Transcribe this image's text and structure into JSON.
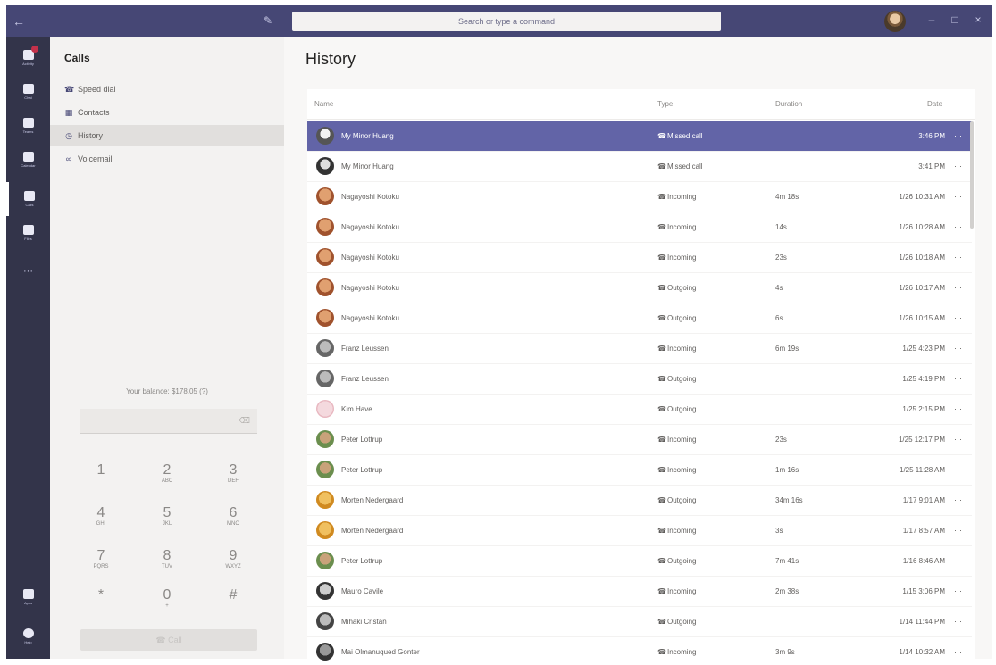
{
  "titlebar": {
    "back_icon": "←",
    "compose_icon": "✎",
    "search_placeholder": "Search or type a command",
    "minimize": "–",
    "maximize": "□",
    "close": "×"
  },
  "appbar": {
    "items": [
      {
        "label": "Activity",
        "icon": "bell-icon"
      },
      {
        "label": "Chat",
        "icon": "chat-icon"
      },
      {
        "label": "Teams",
        "icon": "teams-icon"
      },
      {
        "label": "Calendar",
        "icon": "calendar-icon"
      },
      {
        "label": "Calls",
        "icon": "phone-icon"
      },
      {
        "label": "Files",
        "icon": "file-icon"
      }
    ],
    "more": "···",
    "bottom": [
      {
        "label": "Apps",
        "icon": "apps-icon"
      },
      {
        "label": "Help",
        "icon": "help-icon"
      }
    ],
    "activity_badge_color": "#c4314b"
  },
  "leftpane": {
    "title": "Calls",
    "nav": [
      {
        "label": "Speed dial",
        "icon": "phone-icon"
      },
      {
        "label": "Contacts",
        "icon": "contacts-icon"
      },
      {
        "label": "History",
        "icon": "history-icon"
      },
      {
        "label": "Voicemail",
        "icon": "voicemail-icon"
      }
    ],
    "balance": "Your balance: $178.05 (?)",
    "keys": [
      {
        "d": "1",
        "l": ""
      },
      {
        "d": "2",
        "l": "ABC"
      },
      {
        "d": "3",
        "l": "DEF"
      },
      {
        "d": "4",
        "l": "GHI"
      },
      {
        "d": "5",
        "l": "JKL"
      },
      {
        "d": "6",
        "l": "MNO"
      },
      {
        "d": "7",
        "l": "PQRS"
      },
      {
        "d": "8",
        "l": "TUV"
      },
      {
        "d": "9",
        "l": "WXYZ"
      },
      {
        "d": "*",
        "l": ""
      },
      {
        "d": "0",
        "l": "+"
      },
      {
        "d": "#",
        "l": ""
      }
    ],
    "call_label": "Call",
    "delete_icon": "⌫"
  },
  "history": {
    "title": "History",
    "columns": {
      "name": "Name",
      "type": "Type",
      "duration": "Duration",
      "date": "Date"
    },
    "rows": [
      {
        "name": "My Minor Huang",
        "type": "Missed call",
        "duration": "",
        "date": "3:46 PM"
      },
      {
        "name": "My Minor Huang",
        "type": "Missed call",
        "duration": "",
        "date": "3:41 PM"
      },
      {
        "name": "Nagayoshi Kotoku",
        "type": "Incoming",
        "duration": "4m 18s",
        "date": "1/26 10:31 AM"
      },
      {
        "name": "Nagayoshi Kotoku",
        "type": "Incoming",
        "duration": "14s",
        "date": "1/26 10:28 AM"
      },
      {
        "name": "Nagayoshi Kotoku",
        "type": "Incoming",
        "duration": "23s",
        "date": "1/26 10:18 AM"
      },
      {
        "name": "Nagayoshi Kotoku",
        "type": "Outgoing",
        "duration": "4s",
        "date": "1/26 10:17 AM"
      },
      {
        "name": "Nagayoshi Kotoku",
        "type": "Outgoing",
        "duration": "6s",
        "date": "1/26 10:15 AM"
      },
      {
        "name": "Franz Leussen",
        "type": "Incoming",
        "duration": "6m 19s",
        "date": "1/25 4:23 PM"
      },
      {
        "name": "Franz Leussen",
        "type": "Outgoing",
        "duration": "",
        "date": "1/25 4:19 PM"
      },
      {
        "name": "Kim Have",
        "type": "Outgoing",
        "duration": "",
        "date": "1/25 2:15 PM"
      },
      {
        "name": "Peter Lottrup",
        "type": "Incoming",
        "duration": "23s",
        "date": "1/25 12:17 PM"
      },
      {
        "name": "Peter Lottrup",
        "type": "Incoming",
        "duration": "1m 16s",
        "date": "1/25 11:28 AM"
      },
      {
        "name": "Morten Nedergaard",
        "type": "Outgoing",
        "duration": "34m 16s",
        "date": "1/17 9:01 AM"
      },
      {
        "name": "Morten Nedergaard",
        "type": "Incoming",
        "duration": "3s",
        "date": "1/17 8:57 AM"
      },
      {
        "name": "Peter Lottrup",
        "type": "Outgoing",
        "duration": "7m 41s",
        "date": "1/16 8:46 AM"
      },
      {
        "name": "Mauro Cavile",
        "type": "Incoming",
        "duration": "2m 38s",
        "date": "1/15 3:06 PM"
      },
      {
        "name": "Mihaki Cristan",
        "type": "Outgoing",
        "duration": "",
        "date": "1/14 11:44 PM"
      },
      {
        "name": "Mai Olmanuqued Gonter",
        "type": "Incoming",
        "duration": "3m 9s",
        "date": "1/14 10:32 AM"
      }
    ],
    "more_icon": "···",
    "accent": "#6264a7"
  }
}
